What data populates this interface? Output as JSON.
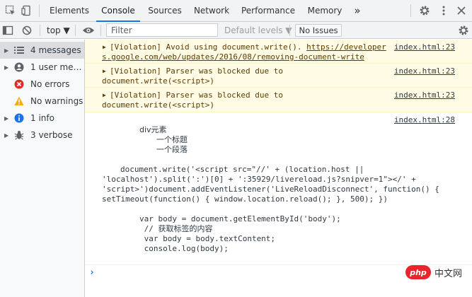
{
  "tabs": [
    {
      "label": "Elements"
    },
    {
      "label": "Console"
    },
    {
      "label": "Sources"
    },
    {
      "label": "Network"
    },
    {
      "label": "Performance"
    },
    {
      "label": "Memory"
    }
  ],
  "more_tabs": "»",
  "toolbar": {
    "context": "top ▼",
    "filter_placeholder": "Filter",
    "levels": "Default levels ▼",
    "issues": "No Issues"
  },
  "sidebar": {
    "items": [
      {
        "label": "4 messages",
        "icon": "list-icon"
      },
      {
        "label": "1 user mess…",
        "icon": "user-icon"
      },
      {
        "label": "No errors",
        "icon": "error-icon"
      },
      {
        "label": "No warnings",
        "icon": "warning-icon"
      },
      {
        "label": "1 info",
        "icon": "info-icon"
      },
      {
        "label": "3 verbose",
        "icon": "bug-icon"
      }
    ]
  },
  "messages": [
    {
      "source": "index.html:23",
      "line1_prefix": "[Violation] Avoid using document.write(). ",
      "line1_link": "https://developer",
      "line2_link": "s.google.com/web/updates/2016/08/removing-document-write"
    },
    {
      "source": "index.html:23",
      "line1": "[Violation] Parser was blocked due to",
      "line2": "document.write(<script>)"
    },
    {
      "source": "index.html:23",
      "line1": "[Violation] Parser was blocked due to",
      "line2": "document.write(<script>)"
    }
  ],
  "log": {
    "source": "index.html:28",
    "html_line1": "div元素",
    "html_line2": "一个标题",
    "html_line3": "一个段落",
    "script1_line1": "document.write('<script src=\"//' + (location.host ||",
    "script1_line2": "'localhost').split(':')[0] + ':35929/livereload.js?snipver=1\"></' +",
    "script1_line3": "'script>')document.addEventListener('LiveReloadDisconnect', function() {",
    "script1_line4": "setTimeout(function() { window.location.reload(); }, 500); })",
    "script2_line1": "var body = document.getElementById('body');",
    "script2_line2": " // 获取标签的内容",
    "script2_line3": " var body = body.textContent;",
    "script2_line4": " console.log(body);"
  },
  "prompt": "›",
  "watermark": {
    "logo": "php",
    "text": "中文网"
  },
  "colors": {
    "accent": "#1a73e8",
    "warning_bg": "#fffbe5",
    "error": "#d93025",
    "warning": "#f9ab00",
    "info": "#1a73e8"
  }
}
